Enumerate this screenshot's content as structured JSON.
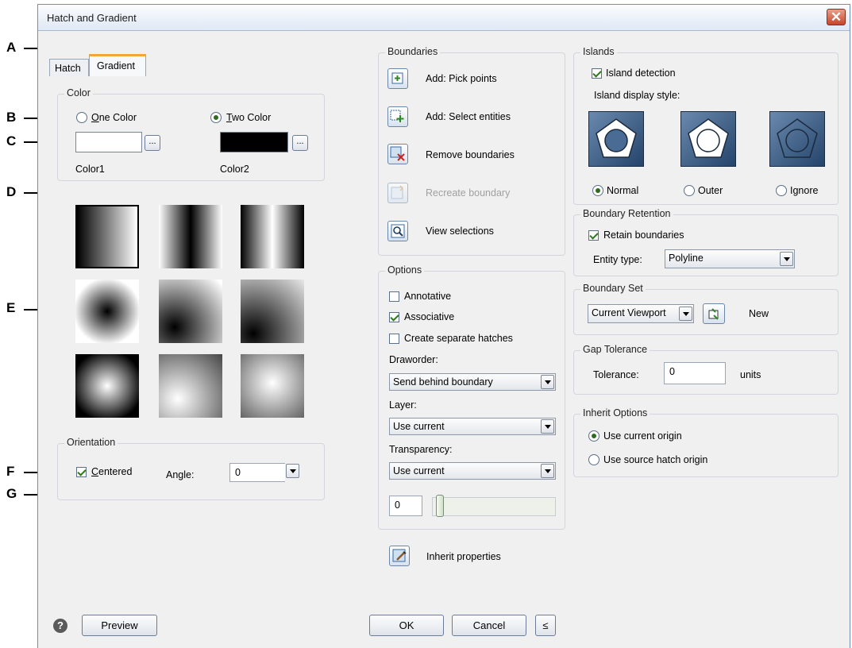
{
  "window": {
    "title": "Hatch and Gradient",
    "close_glyph": "✕"
  },
  "tabs": [
    {
      "label": "Hatch",
      "active": false
    },
    {
      "label": "Gradient",
      "active": true
    }
  ],
  "color_group": {
    "title": "Color",
    "one_color": {
      "label": "One Color",
      "selected": false
    },
    "two_color": {
      "label": "Two Color",
      "selected": true
    },
    "color1_label": "Color1",
    "color2_label": "Color2",
    "color1_value": "#ffffff",
    "color2_value": "#000000",
    "ellipsis": "..."
  },
  "orientation": {
    "title": "Orientation",
    "centered_label": "Centered",
    "centered_checked": true,
    "angle_label": "Angle:",
    "angle_value": "0"
  },
  "boundaries": {
    "title": "Boundaries",
    "items": [
      {
        "label": "Add: Pick points",
        "icon": "pick-points-icon",
        "enabled": true
      },
      {
        "label": "Add: Select entities",
        "icon": "select-entities-icon",
        "enabled": true
      },
      {
        "label": "Remove boundaries",
        "icon": "remove-boundaries-icon",
        "enabled": true
      },
      {
        "label": "Recreate boundary",
        "icon": "recreate-boundary-icon",
        "enabled": false
      },
      {
        "label": "View selections",
        "icon": "view-selections-icon",
        "enabled": true
      }
    ]
  },
  "options": {
    "title": "Options",
    "annotative": {
      "label": "Annotative",
      "checked": false
    },
    "associative": {
      "label": "Associative",
      "checked": true
    },
    "separate": {
      "label": "Create separate hatches",
      "checked": false
    },
    "draworder_label": "Draworder:",
    "draworder_value": "Send behind boundary",
    "layer_label": "Layer:",
    "layer_value": "Use current",
    "transparency_label": "Transparency:",
    "transparency_value": "Use current",
    "transparency_number": "0"
  },
  "inherit_properties_label": "Inherit properties",
  "islands": {
    "title": "Islands",
    "detection_label": "Island detection",
    "detection_checked": true,
    "display_style_label": "Island display style:",
    "styles": [
      {
        "label": "Normal",
        "selected": true
      },
      {
        "label": "Outer",
        "selected": false
      },
      {
        "label": "Ignore",
        "selected": false
      }
    ]
  },
  "boundary_retention": {
    "title": "Boundary Retention",
    "retain_label": "Retain boundaries",
    "retain_checked": true,
    "entity_type_label": "Entity type:",
    "entity_type_value": "Polyline"
  },
  "boundary_set": {
    "title": "Boundary Set",
    "value": "Current Viewport",
    "new_label": "New"
  },
  "gap_tolerance": {
    "title": "Gap Tolerance",
    "tolerance_label": "Tolerance:",
    "tolerance_value": "0",
    "units_label": "units"
  },
  "inherit_options": {
    "title": "Inherit Options",
    "use_current": {
      "label": "Use current origin",
      "selected": true
    },
    "use_source": {
      "label": "Use source hatch origin",
      "selected": false
    }
  },
  "footer": {
    "help_glyph": "?",
    "preview_label": "Preview",
    "ok_label": "OK",
    "cancel_label": "Cancel",
    "collapse_label": "≤"
  },
  "callouts": [
    "A",
    "B",
    "C",
    "D",
    "E",
    "F",
    "G"
  ]
}
